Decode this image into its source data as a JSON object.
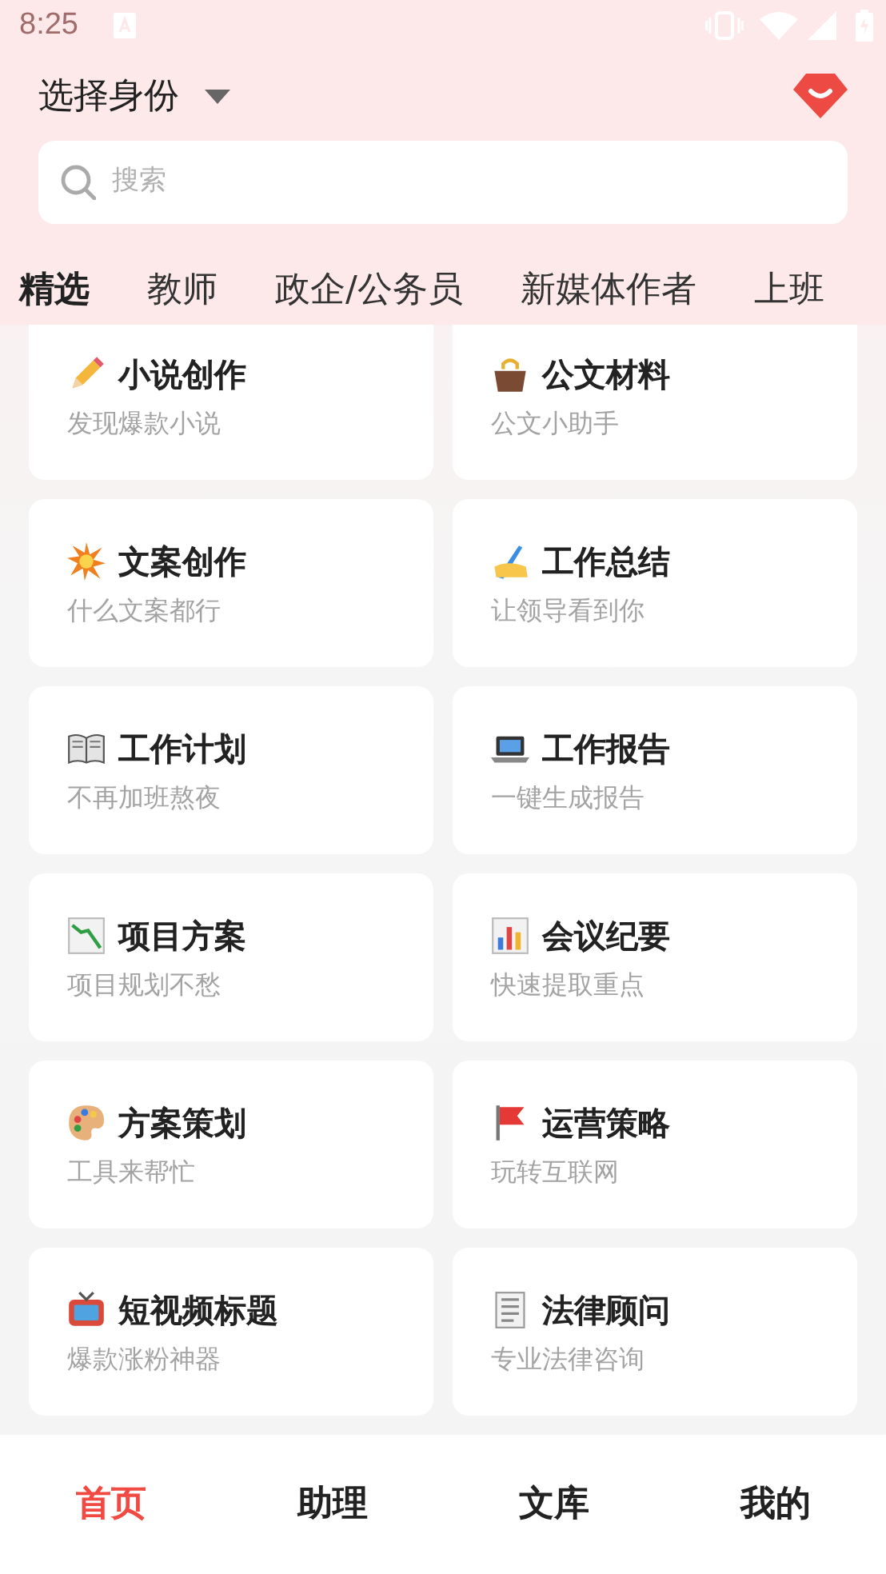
{
  "status_bar": {
    "time": "8:25"
  },
  "header": {
    "identity_label": "选择身份"
  },
  "search": {
    "placeholder": "搜索"
  },
  "tabs": [
    {
      "label": "精选",
      "selected": true
    },
    {
      "label": "教师",
      "selected": false
    },
    {
      "label": "政企/公务员",
      "selected": false
    },
    {
      "label": "新媒体作者",
      "selected": false
    },
    {
      "label": "上班",
      "selected": false
    }
  ],
  "cards": [
    {
      "title": "小说创作",
      "subtitle": "发现爆款小说"
    },
    {
      "title": "公文材料",
      "subtitle": "公文小助手"
    },
    {
      "title": "文案创作",
      "subtitle": "什么文案都行"
    },
    {
      "title": "工作总结",
      "subtitle": "让领导看到你"
    },
    {
      "title": "工作计划",
      "subtitle": "不再加班熬夜"
    },
    {
      "title": "工作报告",
      "subtitle": "一键生成报告"
    },
    {
      "title": "项目方案",
      "subtitle": "项目规划不愁"
    },
    {
      "title": "会议纪要",
      "subtitle": "快速提取重点"
    },
    {
      "title": "方案策划",
      "subtitle": "工具来帮忙"
    },
    {
      "title": "运营策略",
      "subtitle": "玩转互联网"
    },
    {
      "title": "短视频标题",
      "subtitle": "爆款涨粉神器"
    },
    {
      "title": "法律顾问",
      "subtitle": "专业法律咨询"
    }
  ],
  "bottom_nav": [
    {
      "label": "首页",
      "selected": true
    },
    {
      "label": "助理",
      "selected": false
    },
    {
      "label": "文库",
      "selected": false
    },
    {
      "label": "我的",
      "selected": false
    }
  ]
}
